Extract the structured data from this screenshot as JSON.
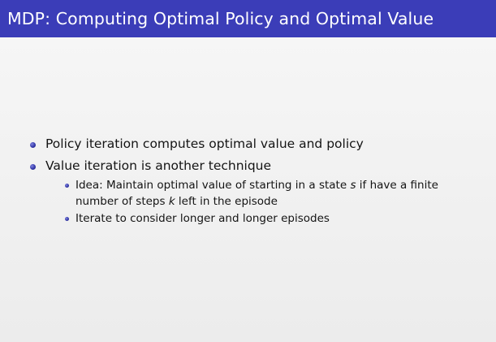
{
  "slide": {
    "title": "MDP: Computing Optimal Policy and Optimal Value",
    "bullets": {
      "b1": "Policy iteration computes optimal value and policy",
      "b2": "Value iteration is another technique",
      "sub1": {
        "part1": "Idea: Maintain optimal value of starting in a state ",
        "var_s": "s",
        "part2": " if have a finite",
        "line2_part1": "number of steps ",
        "var_k": "k",
        "line2_part2": " left in the episode"
      },
      "sub2": "Iterate to consider longer and longer episodes"
    }
  },
  "colors": {
    "title_bar": "#3b3db8",
    "title_text": "#ffffff",
    "bullet": "#2f33a3",
    "background": "#f4f4f4"
  }
}
